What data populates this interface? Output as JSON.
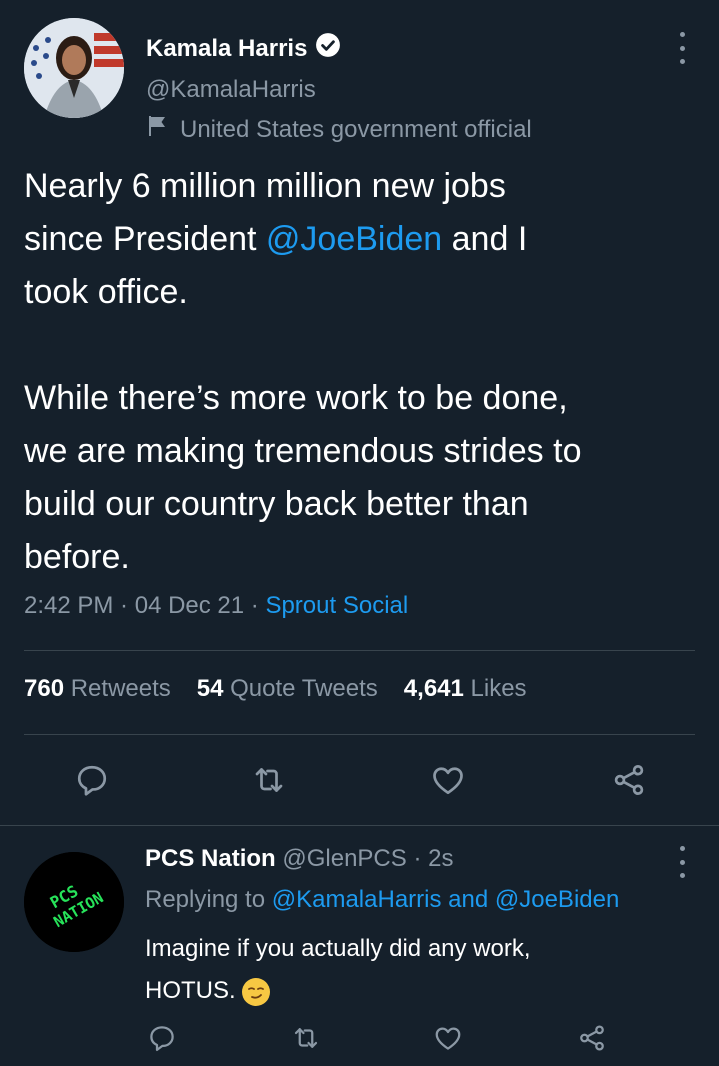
{
  "tweet": {
    "author_name": "Kamala Harris",
    "author_handle": "@KamalaHarris",
    "author_label": "United States government official",
    "text_line_1": "Nearly 6 million million new jobs",
    "text_line_2a": "since President ",
    "mention": "@JoeBiden",
    "text_line_2b": " and I",
    "text_line_3": "took office.",
    "text_para_2": "While there’s more work to be done,\nwe are making tremendous strides to\nbuild our country back better than\nbefore.",
    "time": "2:42 PM",
    "date": "04 Dec 21",
    "source": "Sprout Social",
    "sep": " · ",
    "retweets_count": "760",
    "retweets_label": "Retweets",
    "quotes_count": "54",
    "quotes_label": "Quote Tweets",
    "likes_count": "4,641",
    "likes_label": "Likes"
  },
  "reply": {
    "author_name": "PCS Nation",
    "author_handle": "@GlenPCS",
    "time": "· 2s",
    "replying_prefix": "Replying to ",
    "replying_mention_1": "@KamalaHarris",
    "replying_and": " and ",
    "replying_mention_2": "@JoeBiden",
    "text_line_1": "Imagine if you actually did any work,",
    "text_line_2": "HOTUS.",
    "avatar_text_1": "PCS",
    "avatar_text_2": "NATION"
  },
  "colors": {
    "background": "#15202b",
    "link": "#1d9bf0",
    "muted": "#8b98a5",
    "divider": "#38444d"
  }
}
